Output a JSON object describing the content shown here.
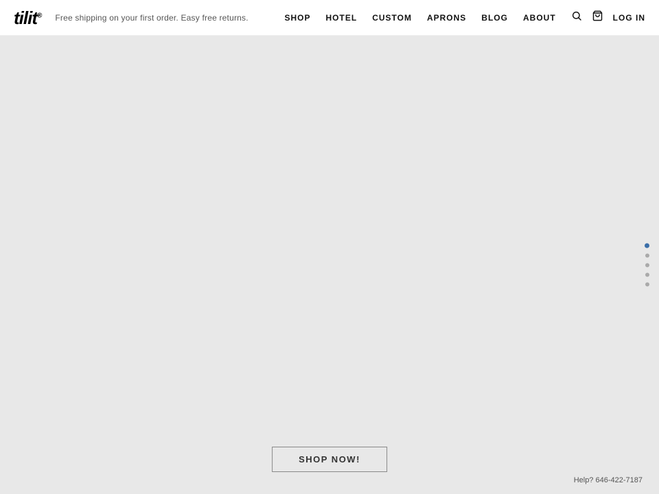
{
  "header": {
    "logo": "tilit",
    "logo_registered": "®",
    "tagline": "Free shipping on your first order. Easy free returns.",
    "nav": {
      "items": [
        {
          "label": "SHOP",
          "id": "shop"
        },
        {
          "label": "HOTEL",
          "id": "hotel"
        },
        {
          "label": "CUSTOM",
          "id": "custom"
        },
        {
          "label": "APRONS",
          "id": "aprons"
        },
        {
          "label": "BLOG",
          "id": "blog"
        },
        {
          "label": "ABOUT",
          "id": "about"
        }
      ],
      "log_in_label": "LOG IN"
    }
  },
  "main": {
    "shop_now_label": "SHOP NOW!"
  },
  "slide_dots": {
    "count": 5,
    "active_index": 0
  },
  "footer": {
    "help_text": "Help? 646-422-7187"
  },
  "icons": {
    "search": "🔍",
    "cart": "🛒"
  }
}
